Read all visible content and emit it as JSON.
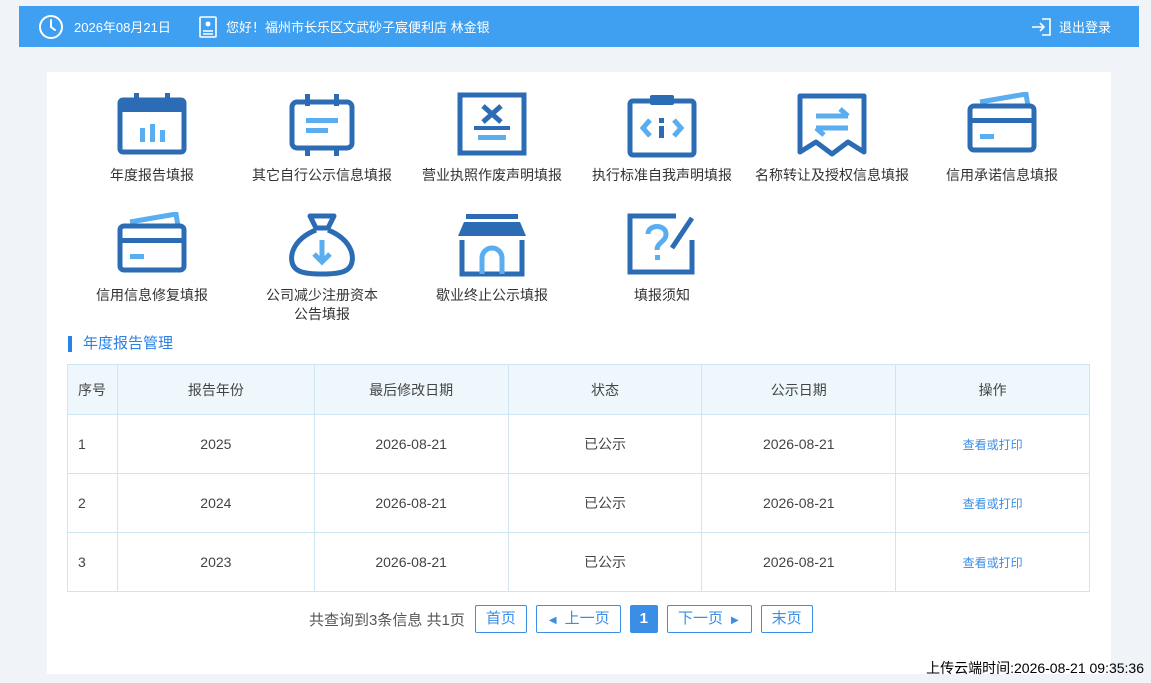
{
  "header": {
    "date": "2026年08月21日",
    "greeting": "您好！福州市长乐区文武砂子宸便利店 林金银",
    "logout": "退出登录"
  },
  "tiles": [
    {
      "label": "年度报告填报",
      "icon": "calendar-chart-icon"
    },
    {
      "label": "其它自行公示信息填报",
      "icon": "easel-board-icon"
    },
    {
      "label": "营业执照作废声明填报",
      "icon": "cancel-document-icon"
    },
    {
      "label": "执行标准自我声明填报",
      "icon": "clipboard-code-icon"
    },
    {
      "label": "名称转让及授权信息填报",
      "icon": "transfer-receipt-icon"
    },
    {
      "label": "信用承诺信息填报",
      "icon": "credit-card-icon"
    },
    {
      "label": "信用信息修复填报",
      "icon": "credit-card-repair-icon"
    },
    {
      "label1": "公司减少注册资本",
      "label2": "公告填报",
      "icon": "money-bag-icon"
    },
    {
      "label": "歇业终止公示填报",
      "icon": "store-icon"
    },
    {
      "label": "填报须知",
      "icon": "question-edit-icon"
    }
  ],
  "section": {
    "title": "年度报告管理"
  },
  "table": {
    "headers": [
      "序号",
      "报告年份",
      "最后修改日期",
      "状态",
      "公示日期",
      "操作"
    ],
    "rows": [
      [
        "1",
        "2025",
        "2026-08-21",
        "已公示",
        "2026-08-21",
        "查看或打印"
      ],
      [
        "2",
        "2024",
        "2026-08-21",
        "已公示",
        "2026-08-21",
        "查看或打印"
      ],
      [
        "3",
        "2023",
        "2026-08-21",
        "已公示",
        "2026-08-21",
        "查看或打印"
      ]
    ]
  },
  "pager": {
    "info": "共查询到3条信息 共1页",
    "first": "首页",
    "prev": "上一页",
    "current": "1",
    "next": "下一页",
    "last": "末页"
  },
  "footer": {
    "upload_time": "上传云端时间:2026-08-21 09:35:36"
  },
  "colors": {
    "accent": "#3fa0f1",
    "icon_dark": "#2b6cb5",
    "icon_light": "#5aaef0"
  }
}
